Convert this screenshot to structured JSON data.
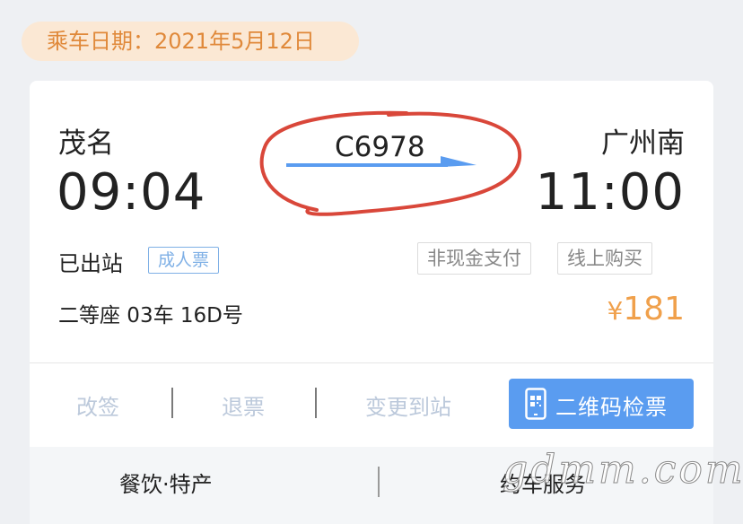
{
  "header": {
    "ride_date": "乘车日期：2021年5月12日"
  },
  "trip": {
    "from_city": "茂名",
    "from_time": "09:04",
    "to_city": "广州南",
    "to_time": "11:00",
    "train_number": "C6978"
  },
  "ticket": {
    "status": "已出站",
    "type_tag": "成人票",
    "payment_tag": "非现金支付",
    "purchase_tag": "线上购买",
    "seat": "二等座 03车 16D号",
    "currency": "¥",
    "price": "181"
  },
  "actions": {
    "change": "改签",
    "refund": "退票",
    "change_station": "变更到站",
    "qr_check": "二维码检票"
  },
  "services": {
    "food": "餐饮·特产",
    "car": "约车服务"
  },
  "watermark": "gdmm.com",
  "colors": {
    "accent": "#5a9cf0",
    "price": "#f0a04b",
    "date_text": "#e0893a",
    "annotation": "#d9473a"
  },
  "icons": {
    "qr": "phone-qr-icon",
    "arrow": "right-arrow-icon"
  }
}
